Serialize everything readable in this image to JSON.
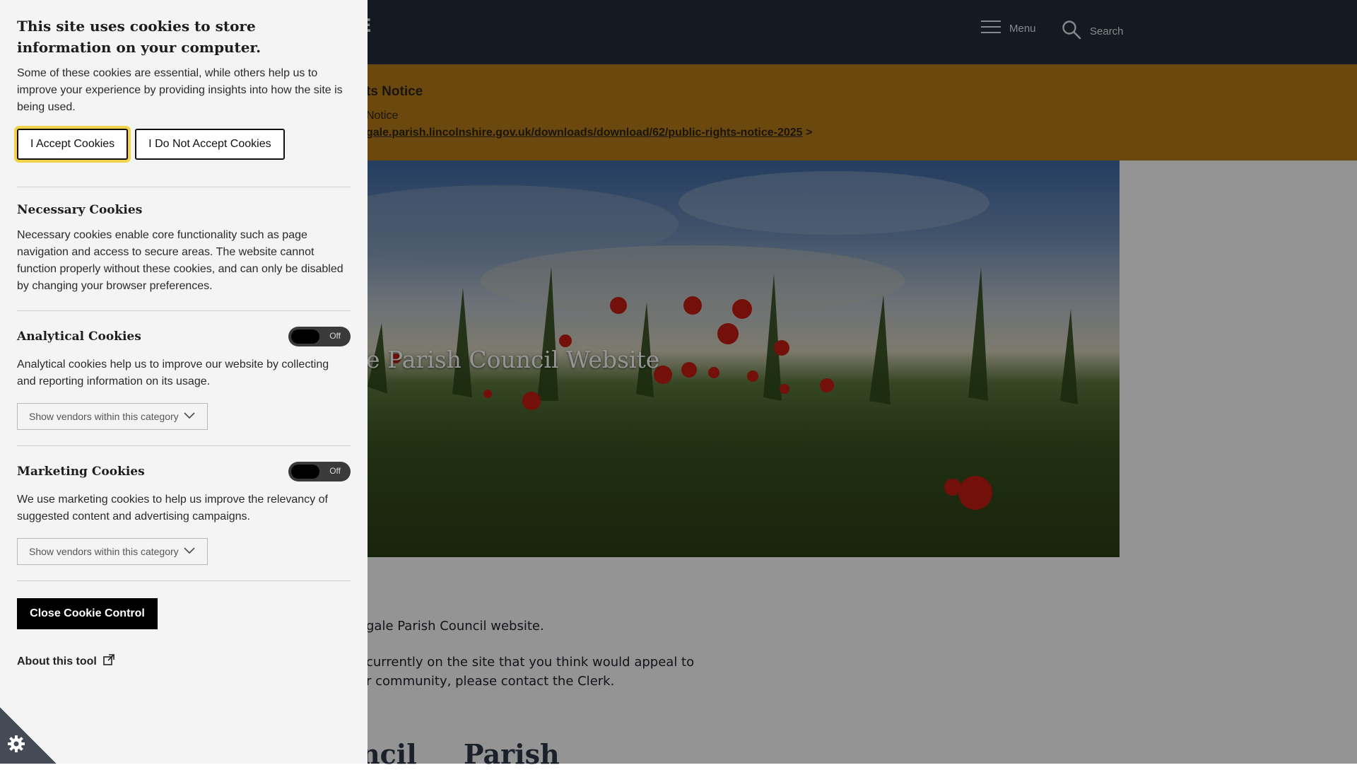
{
  "header": {
    "logo_fragment": "E",
    "menu_label": "Menu",
    "search_label": "Search"
  },
  "notice": {
    "title": "ts Notice",
    "line": "Notice",
    "link_text": "gale.parish.lincolnshire.gov.uk/downloads/download/62/public-rights-notice-2025",
    "link_suffix": " >"
  },
  "hero": {
    "title": "e Parish Council Website"
  },
  "content": {
    "para1": "gale Parish Council website.",
    "para2_line1": "currently on the site that you think would appeal to",
    "para2_line2": "r community, please contact the Clerk.",
    "heading_left": "ncil",
    "heading_right": "Parish"
  },
  "cookie": {
    "title": "This site uses cookies to store information on your computer.",
    "intro": "Some of these cookies are essential, while others help us to improve your experience by providing insights into how the site is being used.",
    "accept_label": "I Accept Cookies",
    "reject_label": "I Do Not Accept Cookies",
    "necessary": {
      "title": "Necessary Cookies",
      "text": "Necessary cookies enable core functionality such as page navigation and access to secure areas. The website cannot function properly without these cookies, and can only be disabled by changing your browser preferences."
    },
    "analytical": {
      "title": "Analytical Cookies",
      "toggle_label": "Off",
      "text": "Analytical cookies help us to improve our website by collecting and reporting information on its usage.",
      "vendor_label": "Show vendors within this category"
    },
    "marketing": {
      "title": "Marketing Cookies",
      "toggle_label": "Off",
      "text": "We use marketing cookies to help us improve the relevancy of suggested content and advertising campaigns.",
      "vendor_label": "Show vendors within this category"
    },
    "close_label": "Close Cookie Control",
    "about_label": "About this tool"
  },
  "colors": {
    "header_bg": "#242d3c",
    "notice_bg": "#b97f19",
    "panel_bg": "#f4f4f4",
    "accept_focus": "#f2d44a"
  },
  "icons": [
    "hamburger-icon",
    "search-icon",
    "chevron-down-icon",
    "external-link-icon",
    "cookie-gear-icon"
  ]
}
